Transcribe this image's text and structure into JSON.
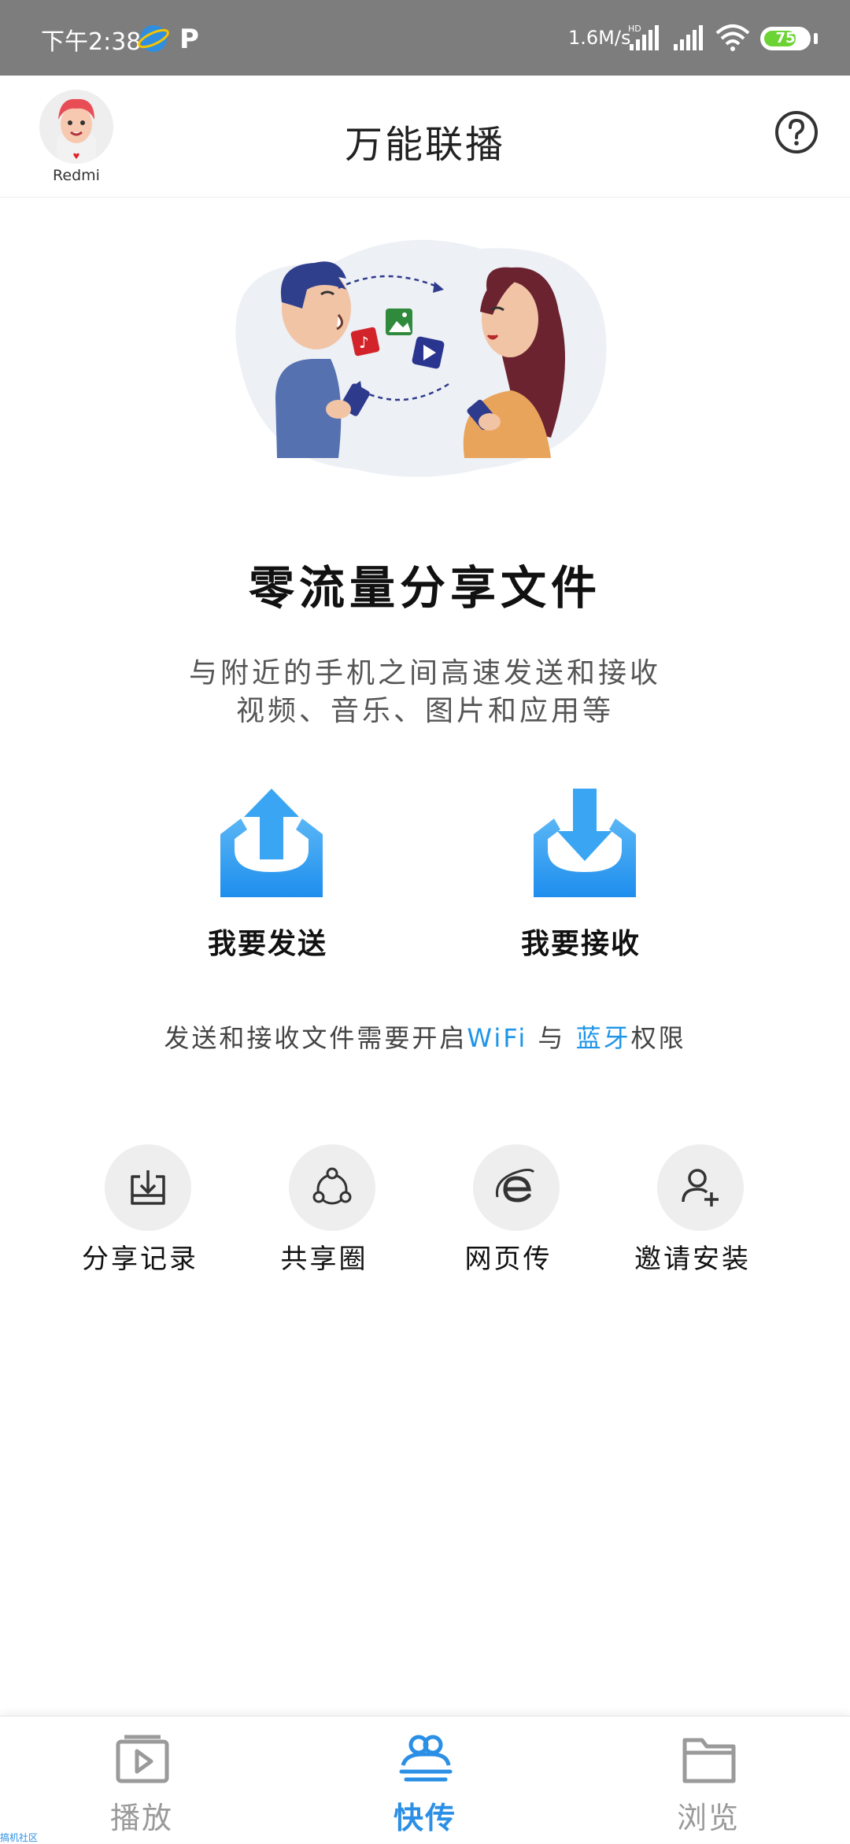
{
  "status_bar": {
    "time": "下午2:38",
    "app2_glyph": "P",
    "net_speed": "1.6M/s",
    "battery": "75",
    "battery_level": 0.75
  },
  "header": {
    "avatar_label": "Redmi",
    "title": "万能联播",
    "help_icon": "question-circle-icon"
  },
  "hero": {
    "headline": "零流量分享文件",
    "subline1": "与附近的手机之间高速发送和接收",
    "subline2": "视频、音乐、图片和应用等"
  },
  "actions": [
    {
      "label": "我要发送",
      "icon": "upload-tray-icon"
    },
    {
      "label": "我要接收",
      "icon": "download-tray-icon"
    }
  ],
  "permission": {
    "prefix": "发送和接收文件需要开启",
    "wifi": "WiFi",
    "conj": " 与 ",
    "bluetooth": "蓝牙",
    "suffix": "权限"
  },
  "tools": [
    {
      "label": "分享记录",
      "icon": "download-box-icon"
    },
    {
      "label": "共享圈",
      "icon": "share-circle-icon"
    },
    {
      "label": "网页传",
      "icon": "browser-e-icon"
    },
    {
      "label": "邀请安装",
      "icon": "add-user-icon"
    }
  ],
  "bottom_nav": [
    {
      "label": "播放",
      "icon": "play-icon",
      "active": false
    },
    {
      "label": "快传",
      "icon": "transfer-users-icon",
      "active": true
    },
    {
      "label": "浏览",
      "icon": "folder-icon",
      "active": false
    }
  ],
  "corner_tag": "搞机社区",
  "colors": {
    "accent": "#2a8fe5",
    "status_bar": "#7d7d7d",
    "battery": "#6cd334"
  }
}
